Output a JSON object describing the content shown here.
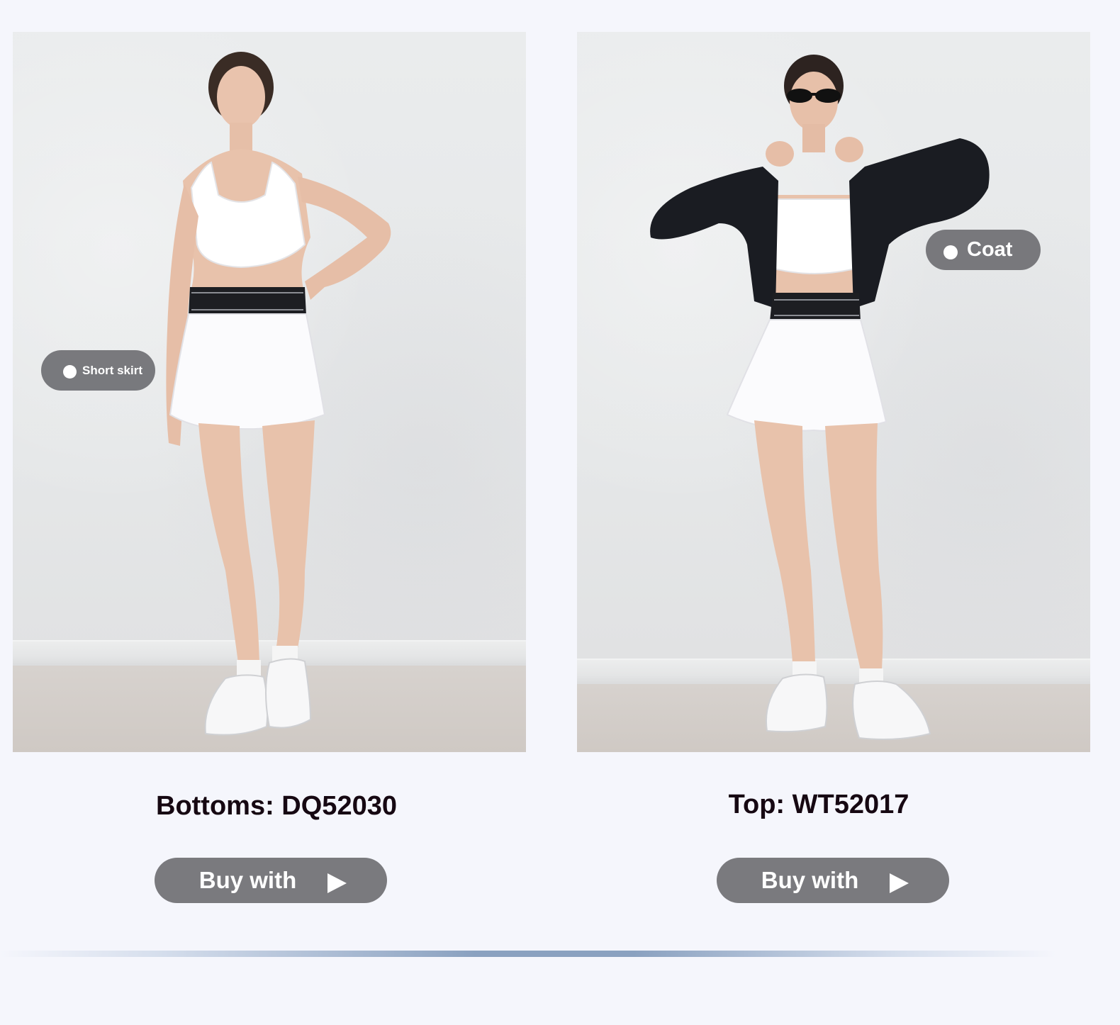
{
  "products": [
    {
      "tag_label": "Short skirt",
      "code_label": "Bottoms: DQ52030",
      "button_label": "Buy with",
      "button_icon": "play-arrow-icon"
    },
    {
      "tag_label": "Coat",
      "code_label": "Top: WT52017",
      "button_label": "Buy with",
      "button_icon": "play-arrow-icon"
    }
  ],
  "colors": {
    "page_background": "#f5f6fc",
    "button_background": "#7a7a7e",
    "tag_background": "#5f5f64",
    "code_text": "#160812",
    "divider": "#8aa1c0"
  }
}
